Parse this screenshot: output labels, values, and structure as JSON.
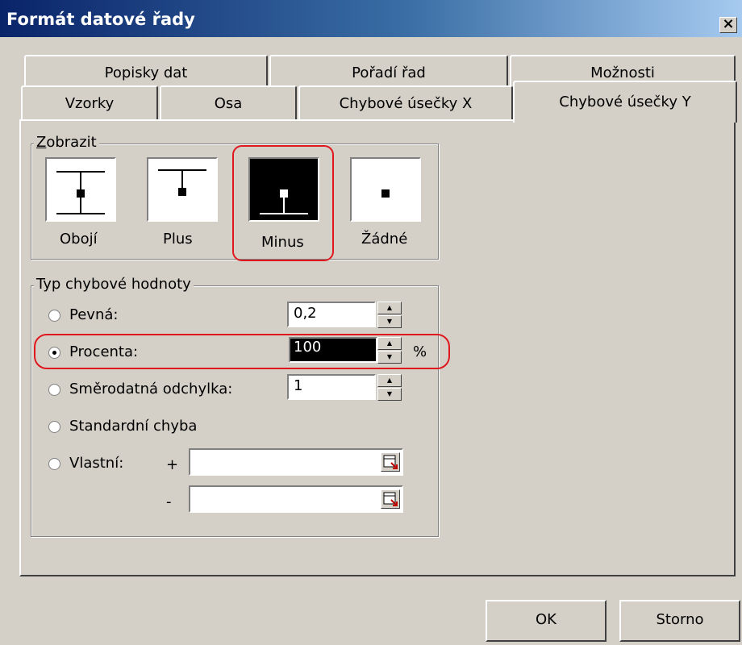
{
  "window": {
    "title": "Formát datové řady",
    "close_glyph": "×"
  },
  "tabs": {
    "row1": [
      "Popisky dat",
      "Pořadí řad",
      "Možnosti"
    ],
    "row2": [
      "Vzorky",
      "Osa",
      "Chybové úsečky X",
      "Chybové úsečky Y"
    ],
    "active": "Chybové úsečky Y"
  },
  "display": {
    "legend": "Zobrazit",
    "options": [
      {
        "label": "Obojí",
        "icon": "error-bar-both-icon"
      },
      {
        "label": "Plus",
        "icon": "error-bar-plus-icon"
      },
      {
        "label": "Minus",
        "icon": "error-bar-minus-icon",
        "selected": true
      },
      {
        "label": "Žádné",
        "icon": "error-bar-none-icon"
      }
    ]
  },
  "error_type": {
    "legend": "Typ chybové hodnoty",
    "fixed": {
      "label": "Pevná:",
      "value": "0,2"
    },
    "percent": {
      "label": "Procenta:",
      "value": "100",
      "unit": "%",
      "selected": true
    },
    "stddev": {
      "label": "Směrodatná odchylka:",
      "value": "1"
    },
    "stderr": {
      "label": "Standardní chyba"
    },
    "custom": {
      "label": "Vlastní:",
      "plus_sign": "+",
      "minus_sign": "-",
      "plus_value": "",
      "minus_value": ""
    }
  },
  "buttons": {
    "ok": "OK",
    "cancel": "Storno"
  },
  "colors": {
    "title_start": "#0a246a",
    "title_end": "#a6caf0",
    "face": "#d4d0c8",
    "annotation": "#e0181e"
  }
}
